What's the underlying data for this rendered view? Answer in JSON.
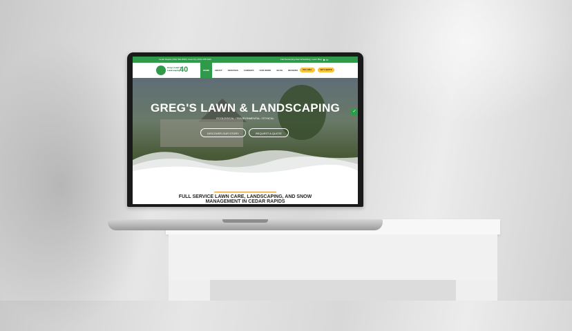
{
  "site": {
    "topbar": {
      "left": "Cedar Rapids (319) 393-3090 | Iowa City (319) 378-5236",
      "right": "Fall Revamping Now Scheduling | Lawn Blog",
      "icons": [
        "youtube-icon",
        "linkedin-icon"
      ]
    },
    "logo": {
      "text": "Greg's Lawn & Landscaping",
      "badge": "40",
      "badge_suffix": "years"
    },
    "nav": {
      "items": [
        "HOME",
        "ABOUT",
        "SERVICES",
        "CAREERS",
        "OUR WORK",
        "BLOG",
        "REVIEWS",
        "CONTACT"
      ],
      "active_index": 0,
      "buttons": [
        "PAY A BILL",
        "GET A QUOTE"
      ]
    },
    "hero": {
      "title": "GREG'S LAWN & LANDSCAPING",
      "subtitle": "ECOLOGICAL / ENVIRONMENTAL / ETHICAL",
      "buttons": [
        "DISCOVER OUR STORY",
        "REQUEST A QUOTE"
      ]
    },
    "tagline": "FULL SERVICE LAWN CARE, LANDSCAPING, AND SNOW MANAGEMENT IN CEDAR RAPIDS"
  },
  "colors": {
    "brand_green": "#2f9a4a",
    "accent_yellow": "#f6c33b",
    "accent_orange": "#e38a2b"
  }
}
